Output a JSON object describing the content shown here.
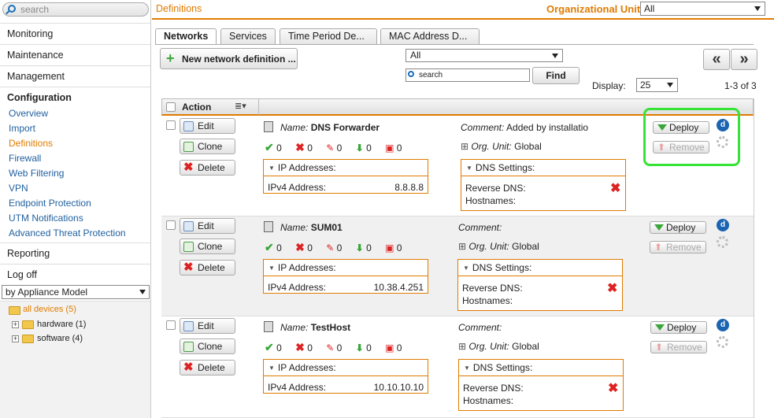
{
  "sidebar": {
    "search_placeholder": "search",
    "nav": [
      "Monitoring",
      "Maintenance",
      "Management",
      "Configuration"
    ],
    "config_items": [
      "Overview",
      "Import",
      "Definitions",
      "Firewall",
      "Web Filtering",
      "VPN",
      "Endpoint Protection",
      "UTM Notifications",
      "Advanced Threat Protection"
    ],
    "nav_bottom": [
      "Reporting",
      "Log off"
    ],
    "grouping_select": "by Appliance Model",
    "tree": {
      "root": "all devices (5)",
      "children": [
        "hardware (1)",
        "software (4)"
      ]
    }
  },
  "header": {
    "title": "Definitions",
    "org_unit_label": "Organizational Unit:",
    "org_unit_value": "All"
  },
  "tabs": [
    "Networks",
    "Services",
    "Time Period De...",
    "MAC Address D..."
  ],
  "toolbar": {
    "new_button": "New network definition ...",
    "filter_value": "All",
    "search_placeholder": "search",
    "find_button": "Find",
    "display_label": "Display:",
    "display_value": "25",
    "count": "1-3 of 3",
    "prev": "«",
    "next": "»"
  },
  "table": {
    "action_header": "Action",
    "labels": {
      "edit": "Edit",
      "clone": "Clone",
      "delete": "Delete",
      "name": "Name:",
      "comment": "Comment:",
      "org_unit": "Org. Unit:",
      "ip_addresses": "IP Addresses:",
      "ipv4": "IPv4 Address:",
      "dns_settings": "DNS Settings:",
      "reverse_dns": "Reverse DNS:",
      "hostnames": "Hostnames:",
      "deploy": "Deploy",
      "remove": "Remove",
      "badge": "d"
    },
    "rows": [
      {
        "name": "DNS Forwarder",
        "comment": "Added by installatio",
        "org_unit": "Global",
        "ipv4": "8.8.8.8",
        "stats": [
          "0",
          "0",
          "0",
          "0",
          "0"
        ]
      },
      {
        "name": "SUM01",
        "comment": "",
        "org_unit": "Global",
        "ipv4": "10.38.4.251",
        "stats": [
          "0",
          "0",
          "0",
          "0",
          "0"
        ]
      },
      {
        "name": "TestHost",
        "comment": "",
        "org_unit": "Global",
        "ipv4": "10.10.10.10",
        "stats": [
          "0",
          "0",
          "0",
          "0",
          "0"
        ]
      }
    ]
  },
  "colors": {
    "accent": "#e07b00",
    "link": "#1f5f9f",
    "highlight": "#37e337",
    "badge": "#1a64b2"
  }
}
